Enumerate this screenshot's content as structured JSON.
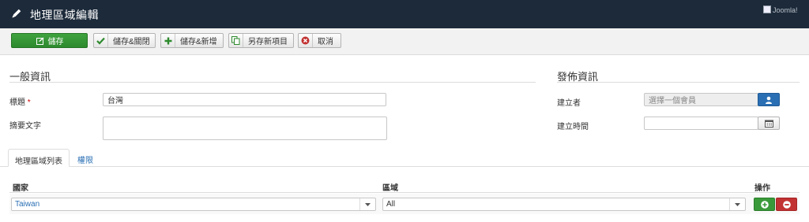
{
  "header": {
    "title": "地理區域編輯",
    "logo_alt": "Joomla!",
    "colors": {
      "bar": "#1c2a3a"
    }
  },
  "toolbar": {
    "save": "儲存",
    "save_close": "儲存&關閉",
    "save_new": "儲存&新增",
    "save_copy": "另存新項目",
    "cancel": "取消"
  },
  "general": {
    "title": "一般資訊",
    "title_label": "標題",
    "required_mark": "*",
    "title_value": "台灣",
    "summary_label": "摘要文字",
    "summary_value": ""
  },
  "publishing": {
    "title": "發佈資訊",
    "created_by_label": "建立者",
    "created_by_placeholder": "選擇一個會員",
    "created_time_label": "建立時間",
    "created_time_value": ""
  },
  "tabs": [
    {
      "label": "地理區域列表",
      "active": true
    },
    {
      "label": "權限",
      "active": false
    }
  ],
  "table": {
    "headers": {
      "country": "國家",
      "region": "區域",
      "actions": "操作"
    },
    "rows": [
      {
        "country": "Taiwan",
        "region": "All"
      }
    ]
  },
  "icons": [
    "edit-pencil-icon",
    "check-icon",
    "plus-icon",
    "copy-icon",
    "cancel-circle-icon",
    "user-icon",
    "calendar-icon",
    "caret-down-icon",
    "add-row-icon",
    "remove-row-icon"
  ]
}
